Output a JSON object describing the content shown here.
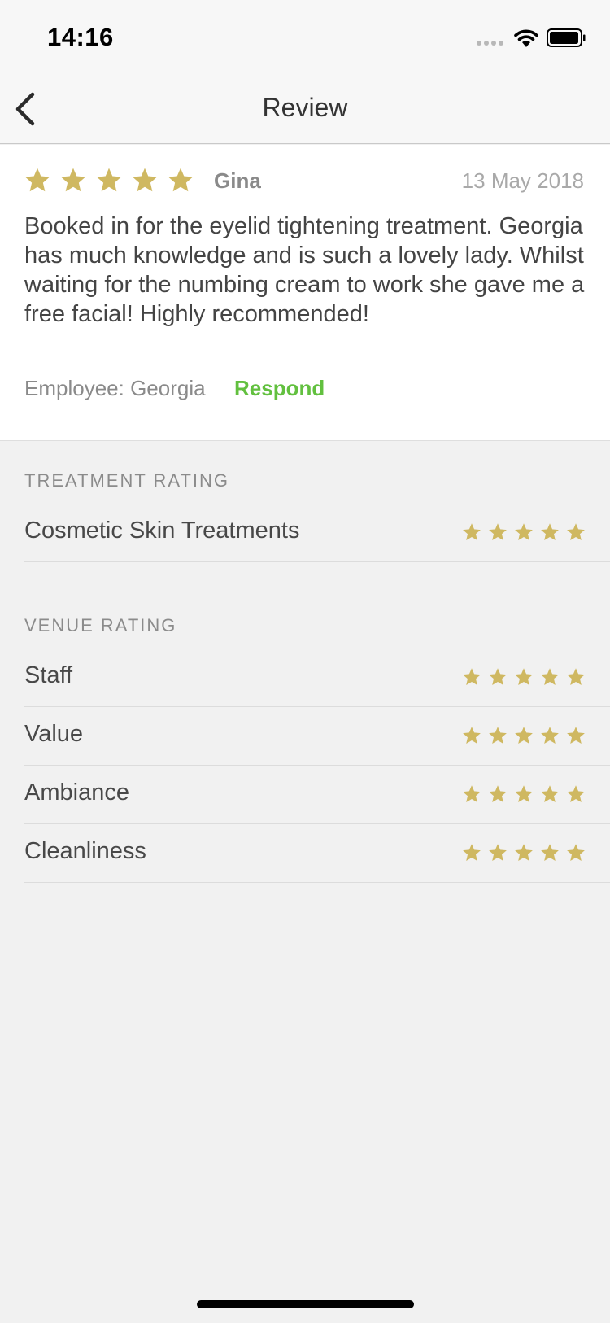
{
  "status_bar": {
    "time": "14:16",
    "icons": [
      "signal-icon",
      "wifi-icon",
      "battery-icon"
    ]
  },
  "nav": {
    "title": "Review",
    "back_icon": "chevron-left-icon"
  },
  "review": {
    "rating": 5,
    "max_rating": 5,
    "reviewer": "Gina",
    "date": "13 May 2018",
    "text": "Booked in for the eyelid tightening treatment. Georgia has much knowledge and is such a lovely lady. Whilst waiting for the numbing cream to work she gave me a free facial! Highly recommended!",
    "employee": "Employee: Georgia",
    "respond_label": "Respond"
  },
  "treatment_rating": {
    "header": "TREATMENT RATING",
    "items": [
      {
        "label": "Cosmetic Skin Treatments",
        "rating": 5
      }
    ]
  },
  "venue_rating": {
    "header": "VENUE RATING",
    "items": [
      {
        "label": "Staff",
        "rating": 5
      },
      {
        "label": "Value",
        "rating": 5
      },
      {
        "label": "Ambiance",
        "rating": 5
      },
      {
        "label": "Cleanliness",
        "rating": 5
      }
    ]
  },
  "colors": {
    "star": "#cfb861",
    "respond": "#62c03f",
    "background": "#f1f1f1"
  }
}
